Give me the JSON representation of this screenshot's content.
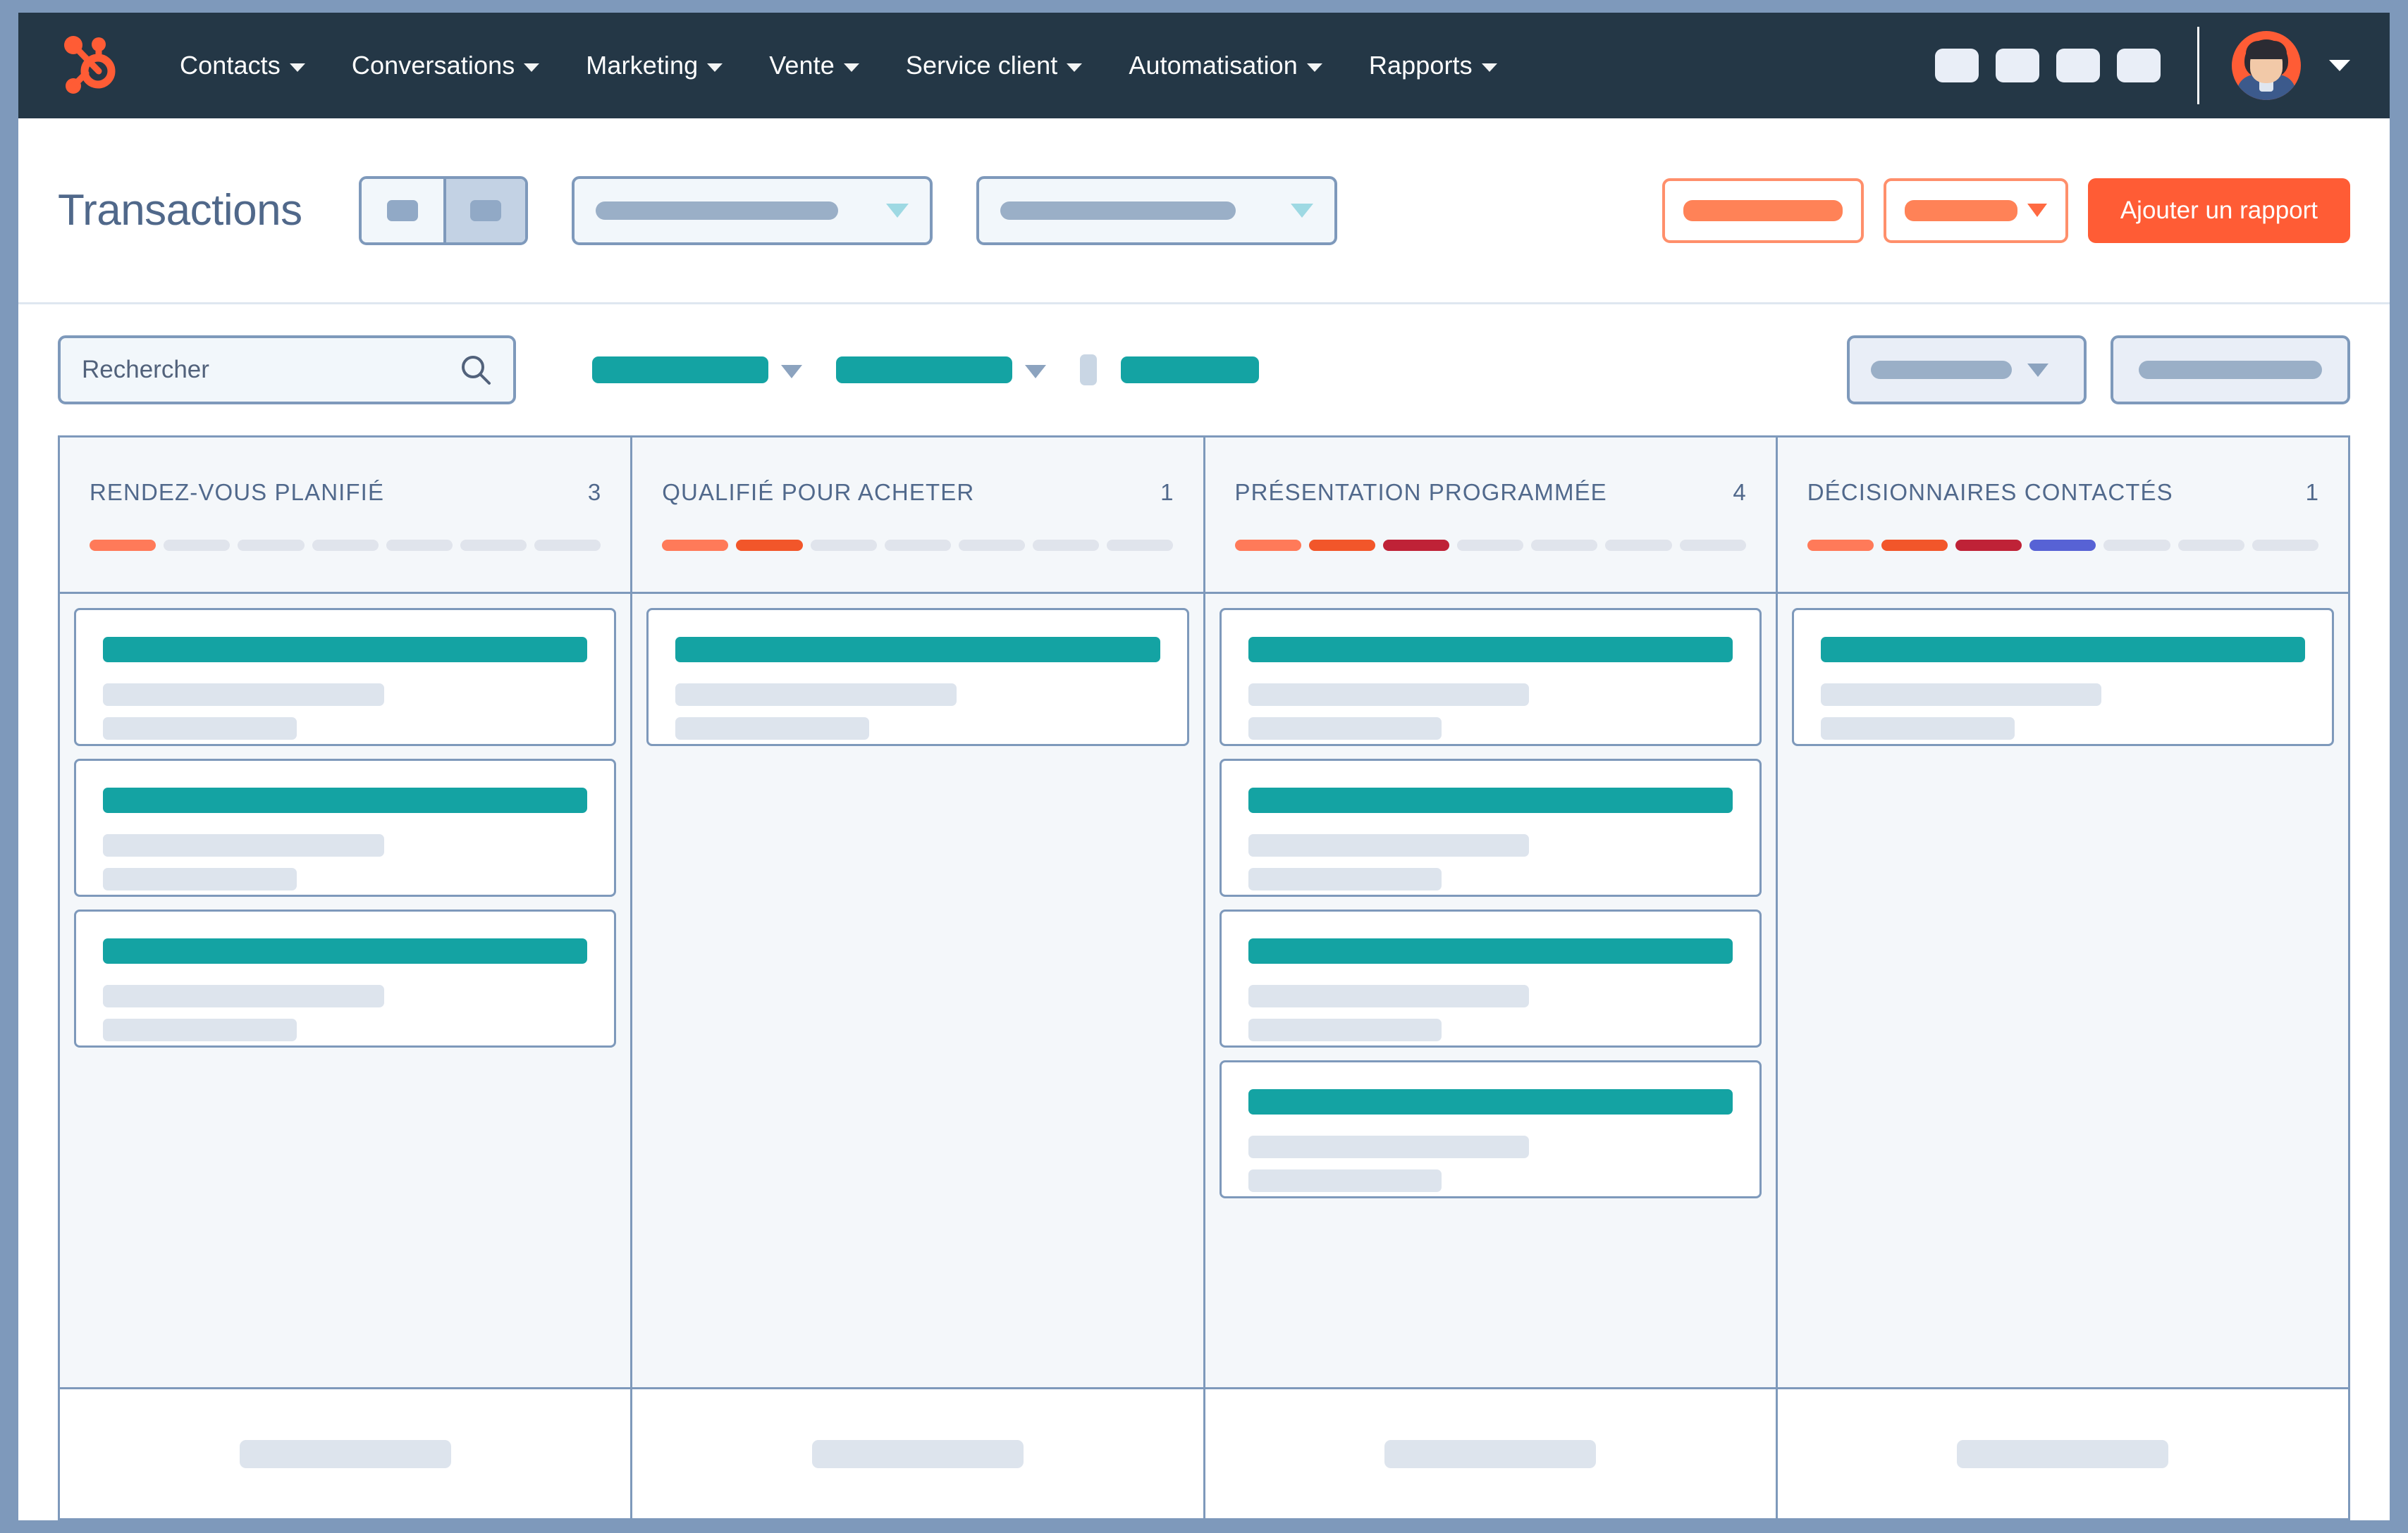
{
  "nav": {
    "logo_icon": "hubspot-sprocket-logo",
    "items": [
      {
        "label": "Contacts",
        "caret": "chevron-down-icon"
      },
      {
        "label": "Conversations",
        "caret": "chevron-down-icon"
      },
      {
        "label": "Marketing",
        "caret": "chevron-down-icon"
      },
      {
        "label": "Vente",
        "caret": "chevron-down-icon"
      },
      {
        "label": "Service client",
        "caret": "chevron-down-icon"
      },
      {
        "label": "Automatisation",
        "caret": "chevron-down-icon"
      },
      {
        "label": "Rapports",
        "caret": "chevron-down-icon"
      }
    ],
    "utility_icons": [
      "settings-icon-placeholder",
      "marketplace-icon-placeholder",
      "help-icon-placeholder",
      "notifications-icon-placeholder"
    ],
    "avatar_icon": "user-avatar",
    "avatar_caret_icon": "chevron-down-icon",
    "background_color": "#243746"
  },
  "header": {
    "title": "Transactions",
    "view_toggle": {
      "options": [
        "list-view",
        "board-view"
      ],
      "active_index": 1
    },
    "selects": [
      {
        "name": "pipeline-select",
        "value_placeholder": "",
        "caret": "chevron-down-icon"
      },
      {
        "name": "owner-select",
        "value_placeholder": "",
        "caret": "chevron-down-icon"
      }
    ],
    "actions": {
      "secondary_button": {
        "label_placeholder": "",
        "name": "actions-button"
      },
      "secondary_dropdown": {
        "label_placeholder": "",
        "caret": "caret-down-icon",
        "name": "import-dropdown"
      },
      "primary_button": {
        "label": "Ajouter un rapport"
      }
    },
    "accent_color": "#ff5c35",
    "title_color": "#50688a"
  },
  "filters": {
    "search": {
      "placeholder": "Rechercher",
      "value": "",
      "icon": "search-icon"
    },
    "chips": [
      {
        "name": "filter-chip-1",
        "caret": "caret-down-icon",
        "color": "#14a3a3"
      },
      {
        "name": "filter-chip-2",
        "caret": "caret-down-icon",
        "color": "#14a3a3"
      },
      {
        "name": "filter-chip-3",
        "color": "#14a3a3"
      }
    ],
    "right_controls": [
      {
        "name": "sort-select",
        "caret": "caret-down-icon"
      },
      {
        "name": "board-settings-field"
      }
    ]
  },
  "board": {
    "stage_colors": [
      "#ff7a59",
      "#f2562a",
      "#bf2237",
      "#5762d5"
    ],
    "empty_stage_color": "#e0e4ec",
    "total_stages": 7,
    "card_title_color": "#14a3a3",
    "columns": [
      {
        "title": "RENDEZ-VOUS PLANIFIÉ",
        "count": "3",
        "stages_filled": 1,
        "cards": [
          {
            "name": "deal-card",
            "line_widths": [
              "58%",
              "40%"
            ]
          },
          {
            "name": "deal-card",
            "line_widths": [
              "58%",
              "40%"
            ]
          },
          {
            "name": "deal-card",
            "line_widths": [
              "58%",
              "40%"
            ]
          }
        ],
        "footer": {
          "name": "add-deal-footer"
        }
      },
      {
        "title": "QUALIFIÉ POUR ACHETER",
        "count": "1",
        "stages_filled": 2,
        "cards": [
          {
            "name": "deal-card",
            "line_widths": [
              "58%",
              "40%"
            ]
          }
        ],
        "footer": {
          "name": "add-deal-footer"
        }
      },
      {
        "title": "PRÉSENTATION PROGRAMMÉE",
        "count": "4",
        "stages_filled": 3,
        "cards": [
          {
            "name": "deal-card",
            "line_widths": [
              "58%",
              "40%"
            ]
          },
          {
            "name": "deal-card",
            "line_widths": [
              "58%",
              "40%"
            ]
          },
          {
            "name": "deal-card",
            "line_widths": [
              "58%",
              "40%"
            ]
          },
          {
            "name": "deal-card",
            "line_widths": [
              "58%",
              "40%"
            ]
          }
        ],
        "footer": {
          "name": "add-deal-footer"
        }
      },
      {
        "title": "DÉCISIONNAIRES CONTACTÉS",
        "count": "1",
        "stages_filled": 4,
        "cards": [
          {
            "name": "deal-card",
            "line_widths": [
              "58%",
              "40%"
            ]
          }
        ],
        "footer": {
          "name": "add-deal-footer"
        }
      }
    ]
  }
}
